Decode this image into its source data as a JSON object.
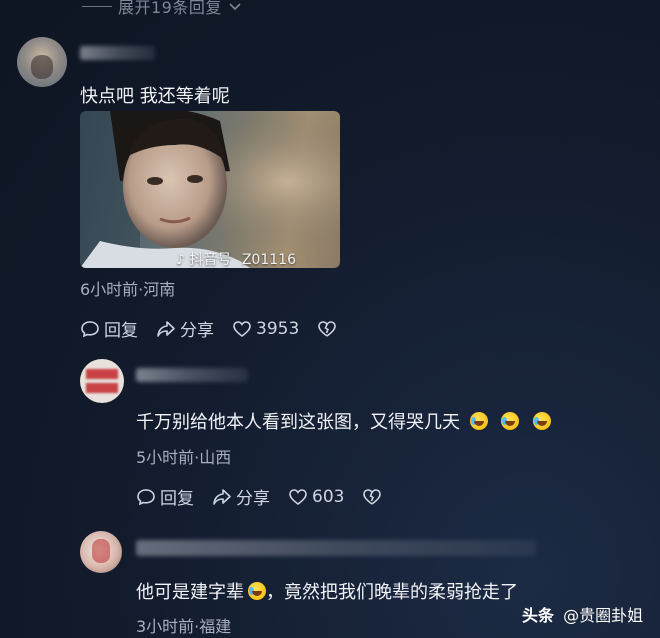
{
  "expand_replies": {
    "label": "展开19条回复",
    "arrow": "chevron-down-icon"
  },
  "comments": [
    {
      "text": "快点吧 我还等着呢",
      "media": {
        "watermark_app": "抖音号",
        "watermark_id": "Z01116"
      },
      "meta": "6小时前·河南",
      "reply_label": "回复",
      "share_label": "分享",
      "like_count": "3953"
    },
    {
      "text": "千万别给他本人看到这张图，又得哭几天",
      "meta": "5小时前·山西",
      "reply_label": "回复",
      "share_label": "分享",
      "like_count": "603"
    },
    {
      "text_before": "他可是建字辈",
      "text_after": "，竟然把我们晚辈的柔弱抢走了",
      "meta": "3小时前·福建"
    }
  ],
  "source_watermark": {
    "brand": "头条",
    "account": "@贵圈卦姐"
  },
  "colors": {
    "background": "#121b2c",
    "text": "#f1f3f7",
    "meta": "#a8afbd"
  }
}
